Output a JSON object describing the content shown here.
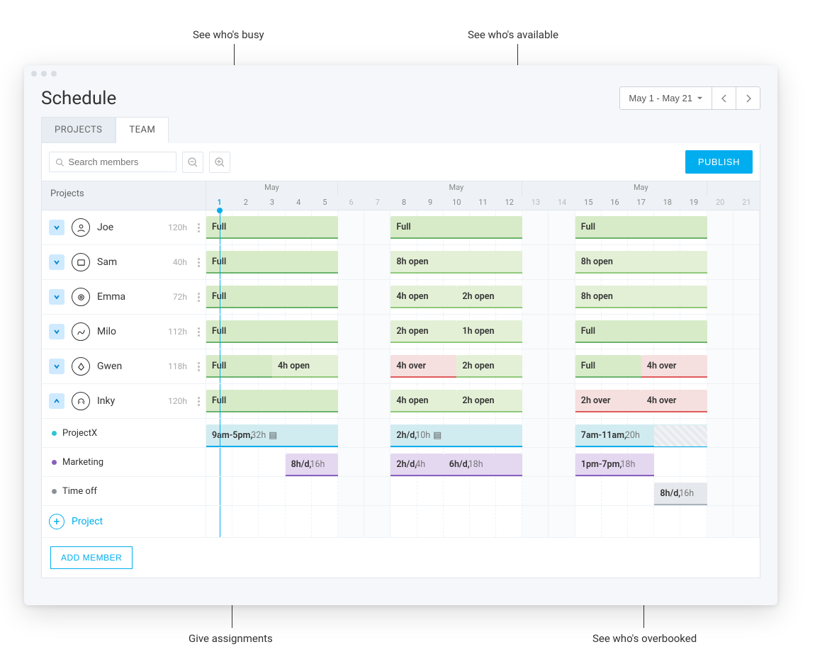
{
  "annotations": {
    "busy": "See who's busy",
    "available": "See who's available",
    "assignments": "Give assignments",
    "overbooked": "See who's overbooked"
  },
  "header": {
    "title": "Schedule",
    "range": "May 1 - May 21"
  },
  "tabs": {
    "projects": "PROJECTS",
    "team": "TEAM"
  },
  "toolbar": {
    "search_placeholder": "Search members",
    "publish": "PUBLISH"
  },
  "columns": {
    "left_header": "Projects",
    "month_label": "May",
    "days": [
      1,
      2,
      3,
      4,
      5,
      6,
      7,
      8,
      9,
      10,
      11,
      12,
      13,
      14,
      15,
      16,
      17,
      18,
      19,
      20,
      21
    ],
    "weekends": [
      6,
      7,
      13,
      14,
      20,
      21
    ],
    "week_breaks": [
      5,
      12,
      19
    ],
    "today": 1,
    "weeks": [
      [
        1,
        5
      ],
      [
        8,
        12
      ],
      [
        15,
        19
      ]
    ]
  },
  "members": [
    {
      "id": "joe",
      "name": "Joe",
      "hours": "120h",
      "blocks": [
        {
          "days": [
            1,
            5
          ],
          "kind": "full",
          "label": "Full"
        },
        {
          "days": [
            8,
            12
          ],
          "kind": "full",
          "label": "Full"
        },
        {
          "days": [
            15,
            19
          ],
          "kind": "full",
          "label": "Full"
        }
      ]
    },
    {
      "id": "sam",
      "name": "Sam",
      "hours": "40h",
      "blocks": [
        {
          "days": [
            1,
            5
          ],
          "kind": "full",
          "label": "Full"
        },
        {
          "days": [
            8,
            12
          ],
          "kind": "open",
          "label": "8h open"
        },
        {
          "days": [
            15,
            19
          ],
          "kind": "open",
          "label": "8h open"
        }
      ]
    },
    {
      "id": "emma",
      "name": "Emma",
      "hours": "72h",
      "blocks": [
        {
          "days": [
            1,
            5
          ],
          "kind": "full",
          "label": "Full"
        },
        {
          "days": [
            8,
            12
          ],
          "kind": "open",
          "split": [
            "4h open",
            "2h open"
          ]
        },
        {
          "days": [
            15,
            19
          ],
          "kind": "open",
          "label": "8h open"
        }
      ]
    },
    {
      "id": "milo",
      "name": "Milo",
      "hours": "112h",
      "blocks": [
        {
          "days": [
            1,
            5
          ],
          "kind": "full",
          "label": "Full"
        },
        {
          "days": [
            8,
            12
          ],
          "kind": "open",
          "split": [
            "2h open",
            "1h open"
          ]
        },
        {
          "days": [
            15,
            19
          ],
          "kind": "full",
          "label": "Full"
        }
      ]
    },
    {
      "id": "gwen",
      "name": "Gwen",
      "hours": "118h",
      "blocks": [
        {
          "days": [
            1,
            5
          ],
          "kind": "mixed",
          "split": [
            "Full",
            "4h open"
          ],
          "kinds": [
            "full",
            "open"
          ]
        },
        {
          "days": [
            8,
            12
          ],
          "kind": "mixed",
          "split": [
            "4h over",
            "2h open"
          ],
          "kinds": [
            "over",
            "open"
          ]
        },
        {
          "days": [
            15,
            19
          ],
          "kind": "mixed",
          "split": [
            "Full",
            "4h over"
          ],
          "kinds": [
            "full",
            "over"
          ]
        }
      ]
    },
    {
      "id": "inky",
      "name": "Inky",
      "hours": "120h",
      "expanded": true,
      "blocks": [
        {
          "days": [
            1,
            5
          ],
          "kind": "full",
          "label": "Full"
        },
        {
          "days": [
            8,
            12
          ],
          "kind": "open",
          "split": [
            "4h open",
            "2h open"
          ]
        },
        {
          "days": [
            15,
            19
          ],
          "kind": "over",
          "split": [
            "2h over",
            "4h over"
          ]
        }
      ]
    }
  ],
  "subrows": [
    {
      "id": "projectx",
      "name": "ProjectX",
      "color": "#2ec4d6",
      "blocks": [
        {
          "days": [
            1,
            5
          ],
          "kind": "proj",
          "label": "9am-5pm,",
          "sub": " 32h",
          "note": true
        },
        {
          "days": [
            8,
            12
          ],
          "kind": "proj",
          "label": "2h/d,",
          "sub": " 10h",
          "note": true
        },
        {
          "days": [
            15,
            19
          ],
          "kind": "proj",
          "label": "7am-11am,",
          "sub": " 20h"
        },
        {
          "days": [
            18,
            19
          ],
          "kind": "hatch"
        }
      ]
    },
    {
      "id": "marketing",
      "name": "Marketing",
      "color": "#8a5fbf",
      "blocks": [
        {
          "days": [
            4,
            5
          ],
          "kind": "mkt",
          "label": "8h/d,",
          "sub": " 16h"
        },
        {
          "days": [
            8,
            9
          ],
          "kind": "mkt",
          "label": "2h/d,",
          "sub": " 4h"
        },
        {
          "days": [
            10,
            12
          ],
          "kind": "mkt",
          "label": "6h/d,",
          "sub": " 18h"
        },
        {
          "days": [
            15,
            17
          ],
          "kind": "mkt",
          "label": "1pm-7pm,",
          "sub": " 18h"
        }
      ]
    },
    {
      "id": "timeoff",
      "name": "Time off",
      "color": "#8a9199",
      "blocks": [
        {
          "days": [
            18,
            19
          ],
          "kind": "off",
          "label": "8h/d,",
          "sub": " 16h"
        }
      ]
    }
  ],
  "actions": {
    "add_project": "Project",
    "add_member": "ADD MEMBER"
  }
}
